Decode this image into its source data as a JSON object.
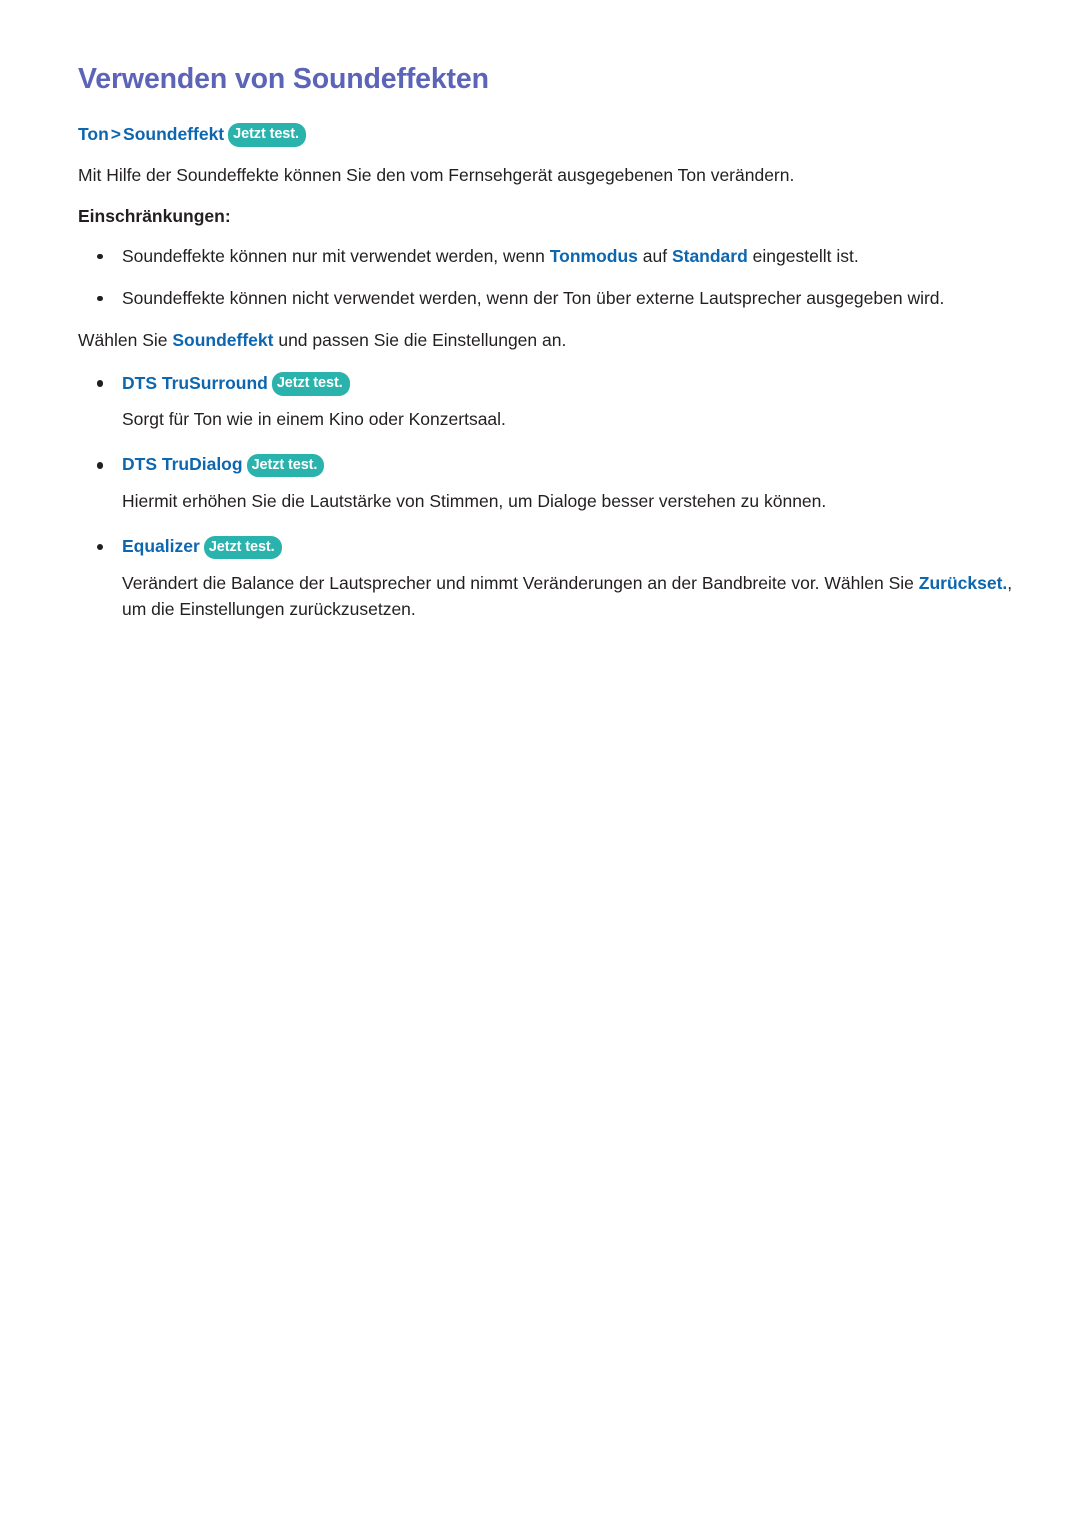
{
  "document": {
    "title": "Verwenden von Soundeffekten",
    "badge_label": "Jetzt test.",
    "path": {
      "root": "Ton",
      "separator": ">",
      "leaf": "Soundeffekt"
    },
    "intro": "Mit Hilfe der Soundeffekte können Sie den vom Fernsehgerät ausgegebenen Ton verändern.",
    "limitations_heading": "Einschränkungen:",
    "limitations": [
      {
        "part1": "Soundeffekte können nur mit verwendet werden, wenn ",
        "em1": "Tonmodus",
        "part2": " auf ",
        "em2": "Standard",
        "part3": " eingestellt ist."
      },
      {
        "part1": "Soundeffekte können nicht verwendet werden, wenn der Ton über externe Lautsprecher ausgegeben wird.",
        "em1": "",
        "part2": "",
        "em2": "",
        "part3": ""
      }
    ],
    "select_line": {
      "part1": "Wählen Sie ",
      "em1": "Soundeffekt",
      "part2": " und passen Sie die Einstellungen an."
    },
    "options": [
      {
        "label": "DTS TruSurround",
        "badge": "Jetzt test.",
        "description": "Sorgt für Ton wie in einem Kino oder Konzertsaal.",
        "description_tail": "",
        "em": ""
      },
      {
        "label": "DTS TruDialog",
        "badge": "Jetzt test.",
        "description": "Hiermit erhöhen Sie die Lautstärke von Stimmen, um Dialoge besser verstehen zu können.",
        "description_tail": "",
        "em": ""
      },
      {
        "label": "Equalizer",
        "badge": "Jetzt test.",
        "description": "Verändert die Balance der Lautsprecher und nimmt Veränderungen an der Bandbreite vor. Wählen Sie ",
        "em": "Zurückset.",
        "description_tail": ", um die  Einstellungen zurückzusetzen."
      }
    ]
  },
  "colors": {
    "title": "#5c64b8",
    "link_blue": "#0d66b0",
    "badge_teal": "#2ab3ac",
    "body_text": "#231f20",
    "background": "#ffffff"
  }
}
